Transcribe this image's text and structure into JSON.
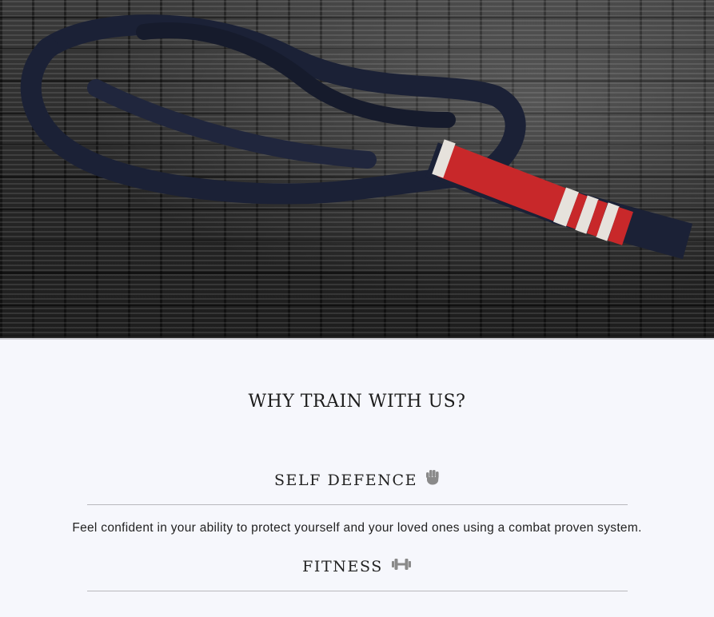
{
  "hero": {
    "image_alt": "dark jiu-jitsu belt with red and white stripes lying on a textured black mat"
  },
  "why": {
    "title": "WHY TRAIN WITH US?"
  },
  "features": [
    {
      "title": "SELF DEFENCE",
      "icon": "fist-icon",
      "text": "Feel confident in your ability to protect yourself and your loved ones using a combat proven system."
    },
    {
      "title": "FITNESS",
      "icon": "dumbbell-icon",
      "text": ""
    }
  ],
  "colors": {
    "background": "#f6f7fc",
    "text": "#222222",
    "rule": "#b8b8bc",
    "icon": "#8a8a8a",
    "belt_navy": "#1b2136",
    "belt_red": "#c8282a"
  }
}
